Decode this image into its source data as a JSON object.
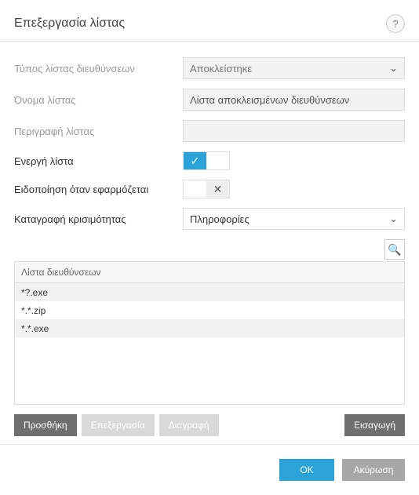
{
  "header": {
    "title": "Επεξεργασία λίστας",
    "help": "?"
  },
  "form": {
    "type_label": "Τύπος λίστας διευθύνσεων",
    "type_value": "Αποκλείστηκε",
    "name_label": "Όνομα λίστας",
    "name_value": "Λίστα αποκλεισμένων διευθύνσεων",
    "desc_label": "Περιγραφή λίστας",
    "desc_value": "",
    "active_label": "Ενεργή λίστα",
    "notify_label": "Ειδοποίηση όταν εφαρμόζεται",
    "severity_label": "Καταγραφή κρισιμότητας",
    "severity_value": "Πληροφορίες"
  },
  "list": {
    "header": "Λίστα διευθύνσεων",
    "rows": [
      "*?.exe",
      "*.*.zip",
      "*.*.exe"
    ]
  },
  "buttons": {
    "add": "Προσθήκη",
    "edit": "Επεξεργασία",
    "delete": "Διαγραφή",
    "import": "Εισαγωγή",
    "ok": "OK",
    "cancel": "Ακύρωση"
  },
  "icons": {
    "check": "✓",
    "cross": "✕",
    "chevron": "⌄",
    "search": "🔍"
  }
}
